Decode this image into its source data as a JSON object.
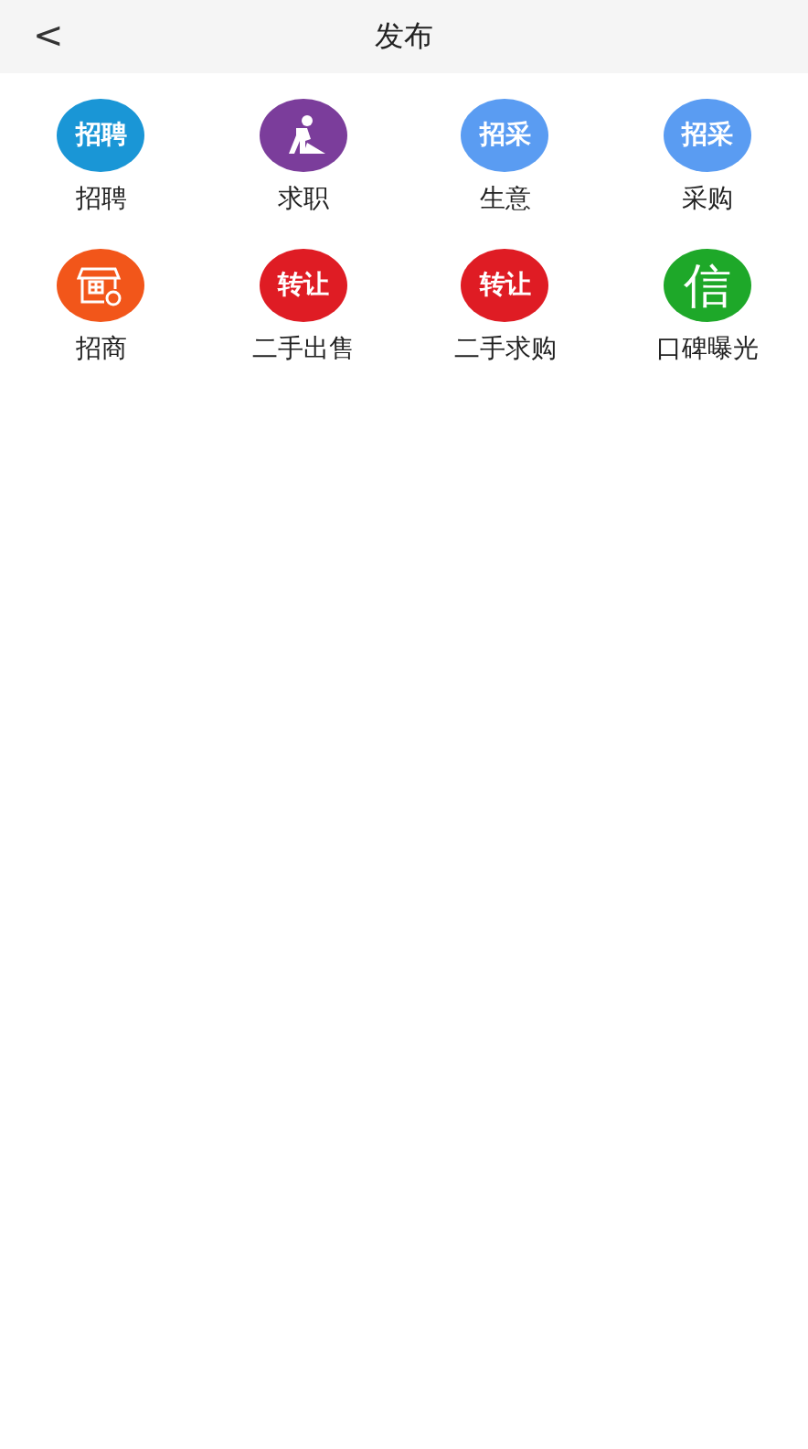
{
  "header": {
    "back": "<",
    "title": "发布"
  },
  "items": [
    {
      "label": "招聘",
      "kind": "text",
      "icon_text": "招聘",
      "color": "#1a96d6"
    },
    {
      "label": "求职",
      "kind": "worker",
      "color": "#7b3d9b"
    },
    {
      "label": "生意",
      "kind": "text",
      "icon_text": "招采",
      "color": "#5a9cf2"
    },
    {
      "label": "采购",
      "kind": "text",
      "icon_text": "招采",
      "color": "#5a9cf2"
    },
    {
      "label": "招商",
      "kind": "shop",
      "color": "#f2561a"
    },
    {
      "label": "二手出售",
      "kind": "text",
      "icon_text": "转让",
      "color": "#df1c24"
    },
    {
      "label": "二手求购",
      "kind": "text",
      "icon_text": "转让",
      "color": "#df1c24"
    },
    {
      "label": "口碑曝光",
      "kind": "text",
      "icon_text": "信",
      "color": "#1ea829"
    }
  ]
}
